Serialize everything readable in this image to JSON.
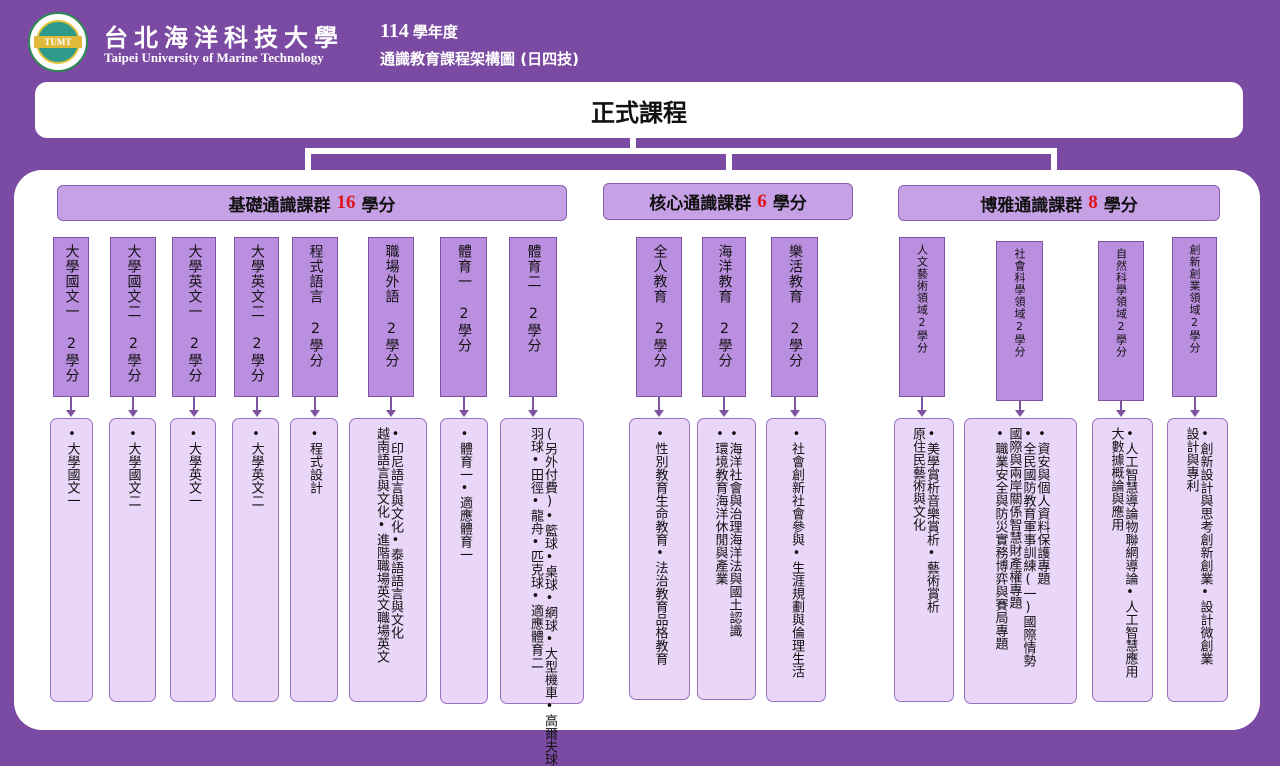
{
  "header": {
    "logo_text": "TUMT",
    "logo_ring_text": "國立臺北海洋科技大學 Taipei University of Marine Technology",
    "university_zh": "台北海洋科技大學",
    "university_en": "Taipei University of Marine Technology",
    "year_num": "114",
    "year_label": "學年度",
    "subtitle": "通識教育課程架構圖 (日四技)"
  },
  "formal": "正式課程",
  "colors": {
    "background": "#7b4aa2",
    "group_fill": "#c7a1e6",
    "course_fill": "#bb8fe0",
    "detail_fill": "#ead6f8",
    "credit_red": "#e0131a"
  },
  "groups": {
    "basic": {
      "name": "基礎通識課群",
      "credits": "16",
      "unit": "學分"
    },
    "core": {
      "name": "核心通識課群",
      "credits": "6",
      "unit": "學分"
    },
    "broad": {
      "name": "博雅通識課群",
      "credits": "8",
      "unit": "學分"
    }
  },
  "courses": [
    {
      "label": "大學國文一 2學分",
      "details": [
        "•大學國文一"
      ]
    },
    {
      "label": "大學國文二 2學分",
      "details": [
        "•大學國文二"
      ]
    },
    {
      "label": "大學英文一 2學分",
      "details": [
        "•大學英文一"
      ]
    },
    {
      "label": "大學英文二 2學分",
      "details": [
        "•大學英文二"
      ]
    },
    {
      "label": "程式語言 2學分",
      "details": [
        "•程式設計"
      ]
    },
    {
      "label": "職場外語 2學分",
      "details": [
        "•印尼語言與文化",
        "•泰語語言與文化",
        "越南語言與文化",
        "•進階職場英文",
        "職場英文"
      ]
    },
    {
      "label": "體育一 2學分",
      "details": [
        "•體育一",
        "•適應體育一"
      ]
    },
    {
      "label": "體育二 2學分",
      "details": [
        "(另外付費)",
        "•籃球•桌球•網球•大型機車•高爾夫球",
        "羽球•田徑•龍舟•匹克球•適應體育二"
      ]
    },
    {
      "label": "全人教育 2學分",
      "details": [
        "•性別教育",
        "生命教育",
        "•法治教育",
        "品格教育"
      ]
    },
    {
      "label": "海洋教育 2學分",
      "details": [
        "•海洋社會與治理",
        "海洋法與國土認識",
        "•環境教育",
        "海洋休閒與產業"
      ]
    },
    {
      "label": "樂活教育 2學分",
      "details": [
        "•社會創新",
        "社會參與",
        "•生涯規劃與倫理生活"
      ]
    },
    {
      "label": "人文藝術領域2學分",
      "details": [
        "•美學賞析",
        "音樂賞析",
        "•藝術賞析",
        "原住民藝術與文化"
      ]
    },
    {
      "label": "社會科學領域2學分",
      "details": [
        "•資安與個人資料保護專題",
        "•全民國防教育軍事訓練(一)國際情勢",
        "國際與兩岸關係",
        "智慧財產權專題",
        "•職業安全與防災實務",
        "博弈與賽局專題"
      ]
    },
    {
      "label": "自然科學領域2學分",
      "details": [
        "•人工智慧導論",
        "物聯網導論",
        "•人工智慧應用",
        "大數據概論與應用"
      ]
    },
    {
      "label": "創新創業領域2學分",
      "details": [
        "•創新設計與思考",
        "創新創業",
        "•設計微創業",
        "設計與專利"
      ]
    }
  ]
}
